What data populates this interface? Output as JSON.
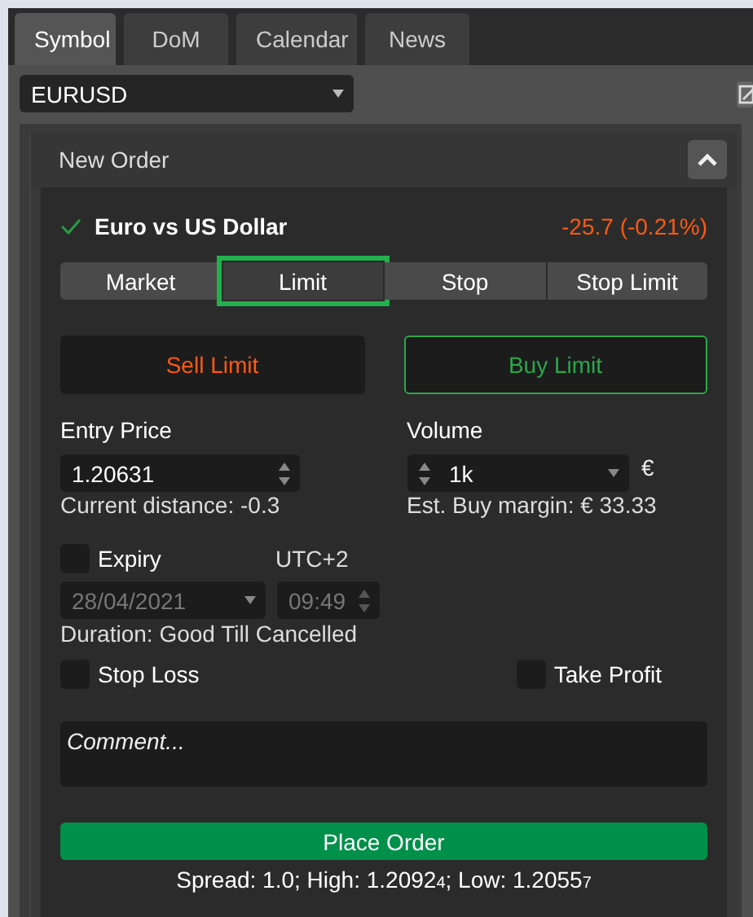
{
  "tabs": [
    {
      "label": "Symbol",
      "selected": true
    },
    {
      "label": "DoM",
      "selected": false
    },
    {
      "label": "Calendar",
      "selected": false
    },
    {
      "label": "News",
      "selected": false
    }
  ],
  "symbol_select": {
    "value": "EURUSD"
  },
  "panel": {
    "title": "New Order",
    "expanded": true
  },
  "instrument": {
    "name": "Euro vs US Dollar",
    "change": "-25.7 (-0.21%)"
  },
  "order_types": [
    {
      "label": "Market",
      "selected": false
    },
    {
      "label": "Limit",
      "selected": true
    },
    {
      "label": "Stop",
      "selected": false
    },
    {
      "label": "Stop Limit",
      "selected": false
    }
  ],
  "sides": [
    {
      "label": "Sell Limit",
      "kind": "sell",
      "selected": false
    },
    {
      "label": "Buy Limit",
      "kind": "buy",
      "selected": true
    }
  ],
  "entry_price": {
    "label": "Entry Price",
    "value": "1.20631",
    "note": "Current distance: -0.3"
  },
  "volume": {
    "label": "Volume",
    "value": "1k",
    "currency": "€",
    "note": "Est. Buy margin: € 33.33"
  },
  "expiry": {
    "label": "Expiry",
    "checked": false,
    "timezone": "UTC+2",
    "date": "28/04/2021",
    "time": "09:49",
    "note": "Duration: Good Till Cancelled"
  },
  "stop_loss": {
    "label": "Stop Loss",
    "checked": false
  },
  "take_profit": {
    "label": "Take Profit",
    "checked": false
  },
  "comment": {
    "placeholder": "Comment..."
  },
  "place_order": "Place Order",
  "footer": "Spread: 1.0; High: 1.2092$_{4}$; Low: 1.2055$_{7}$"
}
